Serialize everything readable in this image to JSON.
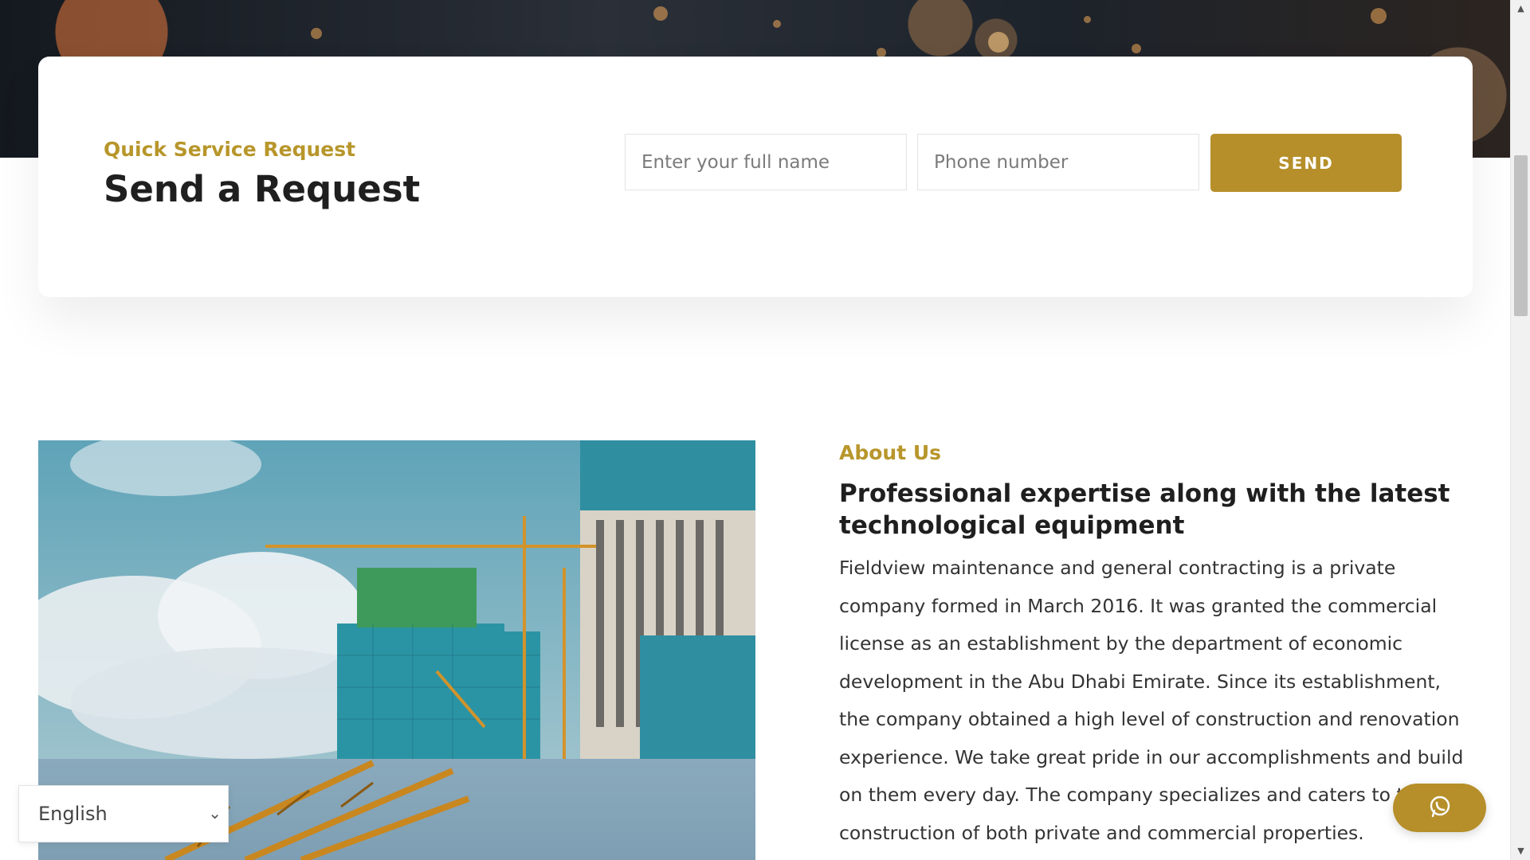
{
  "request_section": {
    "eyebrow": "Quick Service Request",
    "title": "Send a Request",
    "name_placeholder": "Enter your full name",
    "phone_placeholder": "Phone number",
    "send_label": "SEND"
  },
  "about_section": {
    "eyebrow": "About Us",
    "heading": "Professional expertise along with the latest technological equipment",
    "body": "Fieldview maintenance and general contracting is a private company formed in March 2016. It was granted the commercial license as an establishment by the department of economic development in the Abu Dhabi Emirate. Since its establishment, the company obtained a high level of construction and renovation experience. We take great pride in our accomplishments and build on them every day. The company specializes and caters to the construction of both private and commercial properties."
  },
  "language_select": {
    "selected": "English",
    "icon": "chevron-down-icon"
  },
  "whatsapp": {
    "icon": "whatsapp-icon"
  },
  "colors": {
    "accent": "#b68f2a",
    "heading": "#1f1f1f",
    "body_text": "#333333"
  }
}
